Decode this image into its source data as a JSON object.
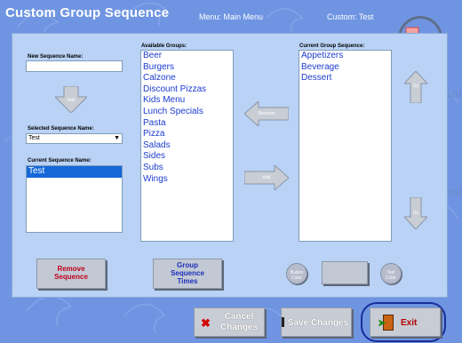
{
  "header": {
    "title": "Custom Group Sequence",
    "menu": "Menu:  Main Menu",
    "custom": "Custom:  Test"
  },
  "left": {
    "new_name_label": "New Sequence Name:",
    "new_name_value": "",
    "add_label": "Add",
    "selected_label": "Selected Sequence Name:",
    "selected_value": "Test",
    "current_label": "Current Sequence Name:",
    "current_items": [
      "Test"
    ]
  },
  "available": {
    "label": "Available Groups:",
    "items": [
      "Beer",
      "Burgers",
      "Calzone",
      "Discount Pizzas",
      "Kids Menu",
      "Lunch Specials",
      "Pasta",
      "Pizza",
      "Salads",
      "Sides",
      "Subs",
      "Wings"
    ]
  },
  "transfer": {
    "remove_label": "Remove",
    "add_label": "Add"
  },
  "current_group": {
    "label": "Current Group Sequence:",
    "items": [
      "Appetizers",
      "Beverage",
      "Dessert"
    ],
    "up_label": "Up",
    "dn_label": "Dn"
  },
  "buttons": {
    "remove_sequence_line1": "Remove",
    "remove_sequence_line2": "Sequence",
    "group_times_line1": "Group",
    "group_times_line2": "Sequence",
    "group_times_line3": "Times",
    "button_color_line1": "Button",
    "button_color_line2": "Color",
    "text_color_line1": "Text",
    "text_color_line2": "Color",
    "cancel_line1": "Cancel",
    "cancel_line2": "Changes",
    "save": "Save Changes",
    "exit": "Exit"
  },
  "watermark": "mol",
  "colors": {
    "background": "#6f95e2",
    "panel": "#b9d2f5",
    "list_text": "#1b3bd0",
    "selection": "#1468d8",
    "remove_text": "#c0001a",
    "times_text": "#1a2fb8",
    "arrow": "#c9cdd4"
  }
}
